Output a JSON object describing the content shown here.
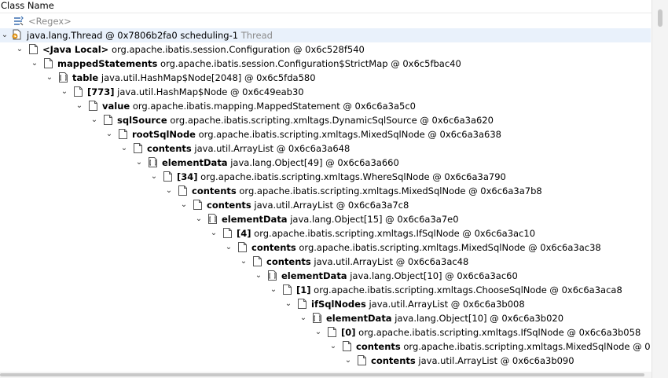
{
  "header": {
    "title": "Class Name"
  },
  "tree": {
    "regex_placeholder": "<Regex>",
    "root": {
      "name": "java.lang.Thread @ 0x7806b2fa0  scheduling-1",
      "suffix": "Thread"
    },
    "rows": [
      {
        "bold": "<Java Local>",
        "rest": " org.apache.ibatis.session.Configuration @ 0x6c528f540",
        "icon": "doc"
      },
      {
        "bold": "mappedStatements",
        "rest": " org.apache.ibatis.session.Configuration$StrictMap @ 0x6c5fbac40",
        "icon": "doc"
      },
      {
        "bold": "table",
        "rest": " java.util.HashMap$Node[2048] @ 0x6c5fda580",
        "icon": "array"
      },
      {
        "bold": "[773]",
        "rest": " java.util.HashMap$Node @ 0x6c49eab30",
        "icon": "doc"
      },
      {
        "bold": "value",
        "rest": " org.apache.ibatis.mapping.MappedStatement @ 0x6c6a3a5c0",
        "icon": "doc"
      },
      {
        "bold": "sqlSource",
        "rest": " org.apache.ibatis.scripting.xmltags.DynamicSqlSource @ 0x6c6a3a620",
        "icon": "doc"
      },
      {
        "bold": "rootSqlNode",
        "rest": " org.apache.ibatis.scripting.xmltags.MixedSqlNode @ 0x6c6a3a638",
        "icon": "doc"
      },
      {
        "bold": "contents",
        "rest": " java.util.ArrayList @ 0x6c6a3a648",
        "icon": "doc"
      },
      {
        "bold": "elementData",
        "rest": " java.lang.Object[49] @ 0x6c6a3a660",
        "icon": "array"
      },
      {
        "bold": "[34]",
        "rest": " org.apache.ibatis.scripting.xmltags.WhereSqlNode @ 0x6c6a3a790",
        "icon": "doc"
      },
      {
        "bold": "contents",
        "rest": " org.apache.ibatis.scripting.xmltags.MixedSqlNode @ 0x6c6a3a7b8",
        "icon": "doc"
      },
      {
        "bold": "contents",
        "rest": " java.util.ArrayList @ 0x6c6a3a7c8",
        "icon": "doc"
      },
      {
        "bold": "elementData",
        "rest": " java.lang.Object[15] @ 0x6c6a3a7e0",
        "icon": "array"
      },
      {
        "bold": "[4]",
        "rest": " org.apache.ibatis.scripting.xmltags.IfSqlNode @ 0x6c6a3ac10",
        "icon": "doc"
      },
      {
        "bold": "contents",
        "rest": " org.apache.ibatis.scripting.xmltags.MixedSqlNode @ 0x6c6a3ac38",
        "icon": "doc"
      },
      {
        "bold": "contents",
        "rest": " java.util.ArrayList @ 0x6c6a3ac48",
        "icon": "doc"
      },
      {
        "bold": "elementData",
        "rest": " java.lang.Object[10] @ 0x6c6a3ac60",
        "icon": "array"
      },
      {
        "bold": "[1]",
        "rest": " org.apache.ibatis.scripting.xmltags.ChooseSqlNode @ 0x6c6a3aca8",
        "icon": "doc"
      },
      {
        "bold": "ifSqlNodes",
        "rest": " java.util.ArrayList @ 0x6c6a3b008",
        "icon": "doc"
      },
      {
        "bold": "elementData",
        "rest": " java.lang.Object[10] @ 0x6c6a3b020",
        "icon": "array"
      },
      {
        "bold": "[0]",
        "rest": " org.apache.ibatis.scripting.xmltags.IfSqlNode @ 0x6c6a3b058",
        "icon": "doc"
      },
      {
        "bold": "contents",
        "rest": " org.apache.ibatis.scripting.xmltags.MixedSqlNode @ 0x6c6a3",
        "icon": "doc"
      },
      {
        "bold": "contents",
        "rest": " java.util.ArrayList @ 0x6c6a3b090",
        "icon": "doc"
      }
    ]
  }
}
